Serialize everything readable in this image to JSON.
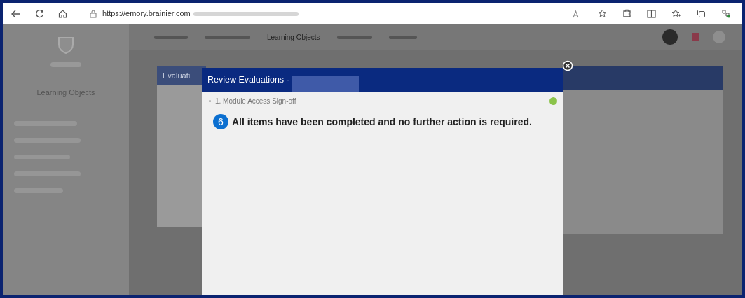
{
  "browser": {
    "url": "https://emory.brainier.com"
  },
  "nav": {
    "tabs": [
      {
        "label": "Learning Objects",
        "selected": true
      }
    ]
  },
  "sidebar": {
    "title": "Learning Objects"
  },
  "background_card": {
    "title": "Evaluati"
  },
  "modal": {
    "title": "Review Evaluations -",
    "items": [
      {
        "label": "1. Module Access Sign-off",
        "completed": true
      }
    ],
    "step_badge": "6",
    "message": "All items have been completed and no further action is required."
  }
}
